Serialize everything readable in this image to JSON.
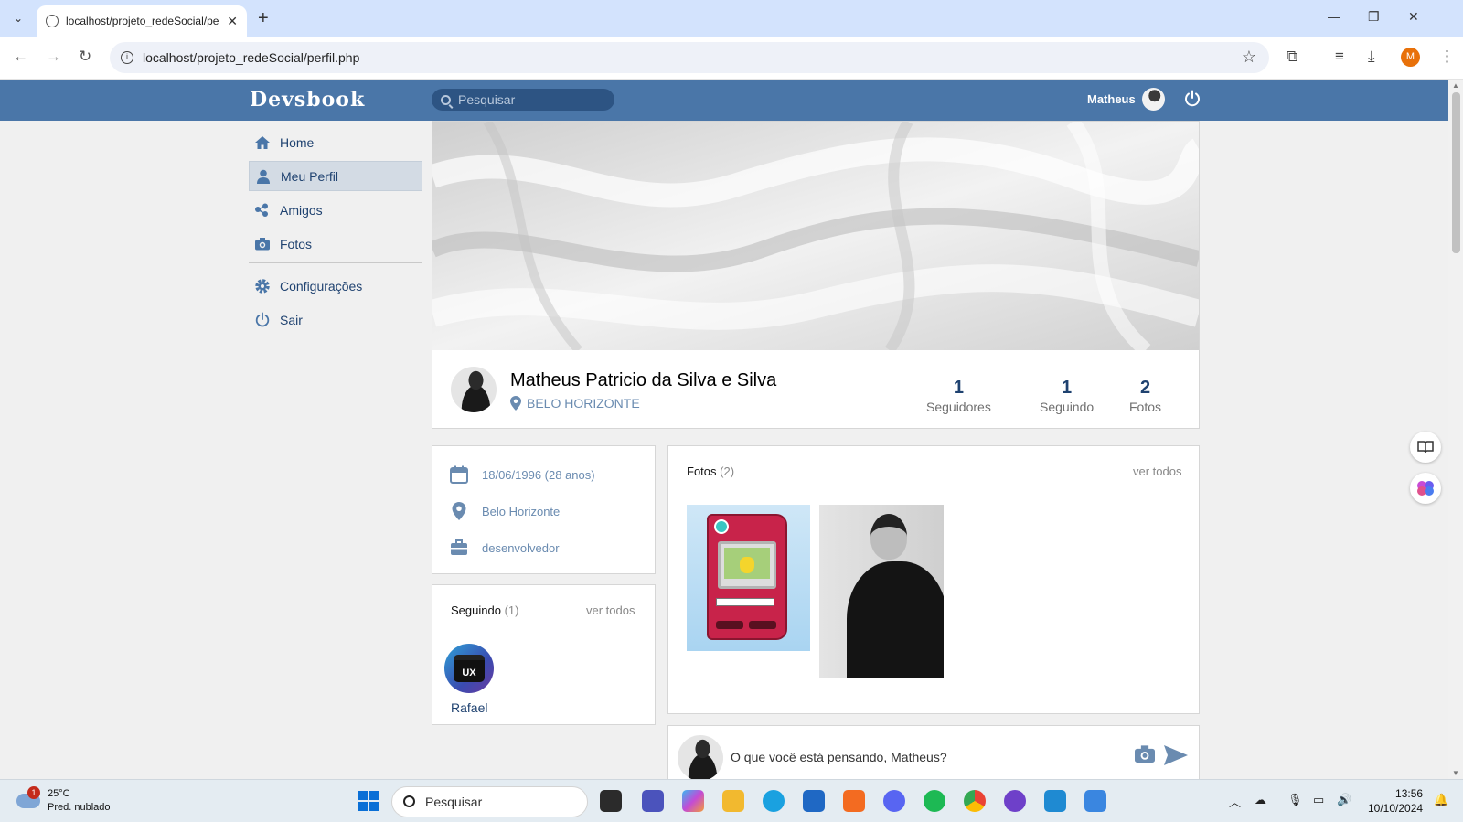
{
  "browser": {
    "tab_title": "localhost/projeto_redeSocial/pe",
    "url": "localhost/projeto_redeSocial/perfil.php"
  },
  "app": {
    "logo": "Devsbook",
    "search_placeholder": "Pesquisar",
    "user_name": "Matheus"
  },
  "menu": {
    "items": [
      {
        "label": "Home",
        "icon": "home-icon"
      },
      {
        "label": "Meu Perfil",
        "icon": "user-icon",
        "active": true
      },
      {
        "label": "Amigos",
        "icon": "friends-icon"
      },
      {
        "label": "Fotos",
        "icon": "camera-icon"
      }
    ],
    "settings_label": "Configurações",
    "logout_label": "Sair"
  },
  "profile": {
    "name": "Matheus Patricio da Silva e Silva",
    "city": "BELO HORIZONTE",
    "stats": [
      {
        "num": "1",
        "label": "Seguidores"
      },
      {
        "num": "1",
        "label": "Seguindo"
      },
      {
        "num": "2",
        "label": "Fotos"
      }
    ]
  },
  "info": {
    "birth": "18/06/1996 (28 anos)",
    "city": "Belo Horizonte",
    "work": "desenvolvedor"
  },
  "following": {
    "title": "Seguindo",
    "count": "(1)",
    "link": "ver todos",
    "friend_name": "Rafael",
    "friend_avatar_text": "UX"
  },
  "photos": {
    "title": "Fotos",
    "count": "(2)",
    "link": "ver todos"
  },
  "composer": {
    "placeholder": "O que você está pensando, Matheus?"
  },
  "taskbar": {
    "weather_temp": "25°C",
    "weather_desc": "Pred. nublado",
    "weather_badge": "1",
    "search_placeholder": "Pesquisar",
    "time": "13:56",
    "date": "10/10/2024"
  },
  "colors": {
    "primary": "#4a76a8",
    "link": "#6a8bb0",
    "menu_text": "#1f4270"
  }
}
